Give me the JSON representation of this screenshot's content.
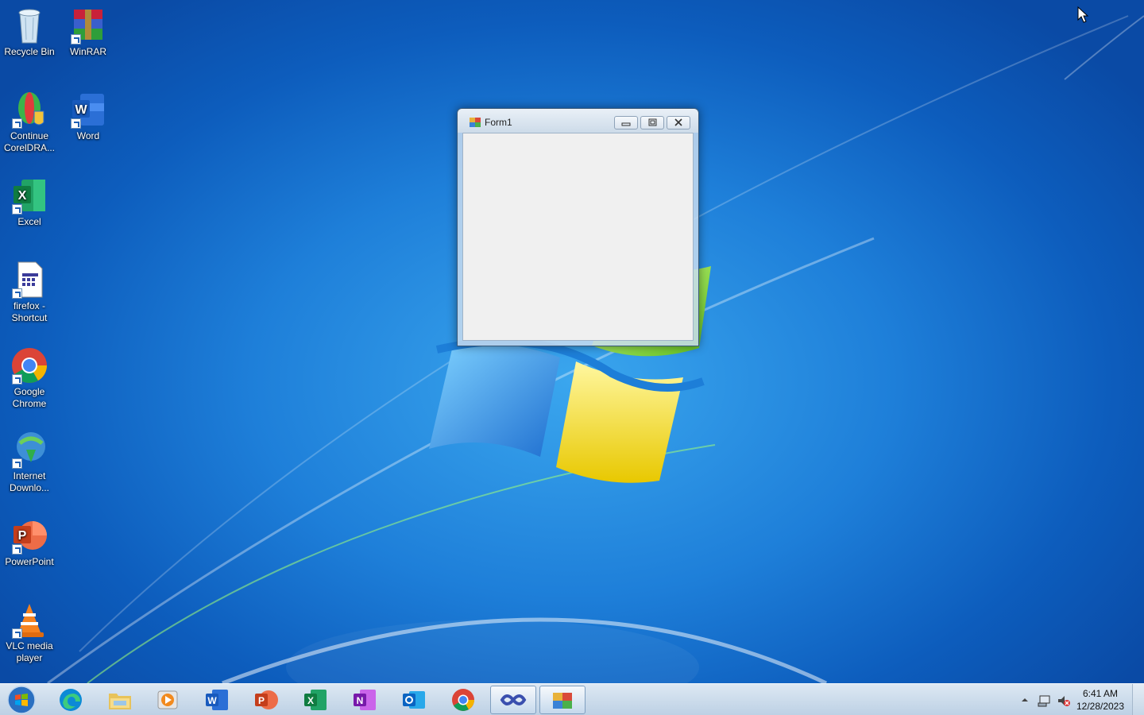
{
  "desktop": {
    "icons": [
      {
        "label": "Recycle Bin",
        "icon": "recycle-bin-icon"
      },
      {
        "label": "WinRAR",
        "icon": "winrar-icon"
      },
      {
        "label": "Continue CorelDRA...",
        "icon": "coreldraw-icon"
      },
      {
        "label": "Word",
        "icon": "word-icon"
      },
      {
        "label": "Excel",
        "icon": "excel-icon"
      },
      {
        "label": "firefox - Shortcut",
        "icon": "firefox-shortcut-icon"
      },
      {
        "label": "Google Chrome",
        "icon": "chrome-icon"
      },
      {
        "label": "Internet Downlo...",
        "icon": "internet-download-manager-icon"
      },
      {
        "label": "PowerPoint",
        "icon": "powerpoint-icon"
      },
      {
        "label": "VLC media player",
        "icon": "vlc-icon"
      }
    ]
  },
  "window": {
    "title": "Form1"
  },
  "taskbar": {
    "items": [
      {
        "name": "edge",
        "icon": "edge-icon"
      },
      {
        "name": "file-explorer",
        "icon": "folder-icon"
      },
      {
        "name": "media-player",
        "icon": "media-player-icon"
      },
      {
        "name": "word",
        "icon": "word-icon"
      },
      {
        "name": "powerpoint",
        "icon": "powerpoint-icon"
      },
      {
        "name": "excel",
        "icon": "excel-icon"
      },
      {
        "name": "onenote",
        "icon": "onenote-icon"
      },
      {
        "name": "outlook",
        "icon": "outlook-icon"
      },
      {
        "name": "chrome",
        "icon": "chrome-icon"
      },
      {
        "name": "visual-studio",
        "icon": "visual-studio-icon"
      },
      {
        "name": "form1-app",
        "icon": "winforms-app-icon"
      }
    ],
    "clock": {
      "time": "6:41 AM",
      "date": "12/28/2023"
    }
  },
  "colors": {
    "wallpaper": "#1e7fd9",
    "taskbar": "#c9daea",
    "form_client": "#f0f0f0"
  }
}
